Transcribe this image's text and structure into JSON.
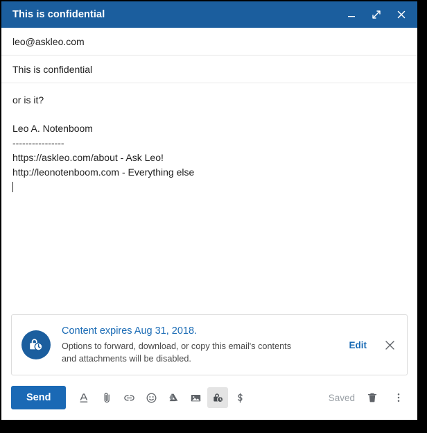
{
  "window": {
    "title": "This is confidential",
    "controls": [
      {
        "name": "minimize-button",
        "icon": "minimize-icon"
      },
      {
        "name": "expand-button",
        "icon": "expand-arrows-icon"
      },
      {
        "name": "close-button",
        "icon": "close-icon"
      }
    ]
  },
  "fields": {
    "to_value": "leo@askleo.com",
    "subject_value": "This is confidential"
  },
  "body": {
    "lines": [
      "or is it?",
      "",
      "Leo A. Notenboom",
      "----------------",
      "https://askleo.com/about - Ask Leo!",
      "http://leonotenboom.com - Everything else"
    ]
  },
  "banner": {
    "icon": "lock-clock-icon",
    "title": "Content expires Aug 31, 2018.",
    "description_line1": "Options to forward, download, or copy this email's contents",
    "description_line2": "and attachments will be disabled.",
    "edit_label": "Edit",
    "close_icon": "close-icon"
  },
  "toolbar": {
    "send_label": "Send",
    "icons": [
      {
        "name": "formatting-options-icon",
        "label": "A"
      },
      {
        "name": "attach-file-icon",
        "label": "paperclip"
      },
      {
        "name": "insert-link-icon",
        "label": "link"
      },
      {
        "name": "insert-emoji-icon",
        "label": "emoji"
      },
      {
        "name": "insert-drive-file-icon",
        "label": "drive"
      },
      {
        "name": "insert-photo-icon",
        "label": "photo"
      },
      {
        "name": "confidential-mode-icon",
        "label": "confidential"
      },
      {
        "name": "insert-money-icon",
        "label": "dollar"
      }
    ],
    "saved_label": "Saved",
    "trash_icon": "trash-icon",
    "more_icon": "more-options-icon"
  },
  "colors": {
    "titlebar": "#1b5e9e",
    "accent_blue": "#1a69b5",
    "link_blue": "#1a6bb5",
    "icon_gray": "#5f6368",
    "muted_gray": "#9aa0a6"
  }
}
